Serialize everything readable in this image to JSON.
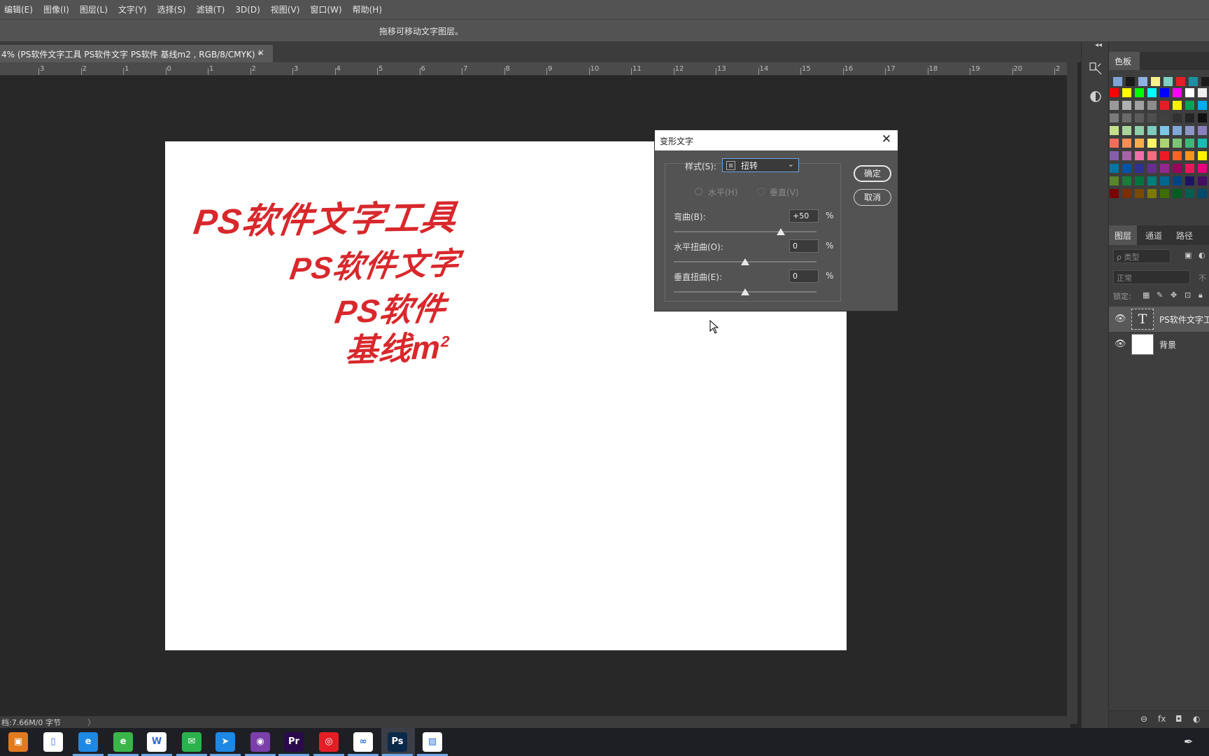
{
  "menu": [
    "编辑(E)",
    "图像(I)",
    "图层(L)",
    "文字(Y)",
    "选择(S)",
    "滤镜(T)",
    "3D(D)",
    "视图(V)",
    "窗口(W)",
    "帮助(H)"
  ],
  "options_hint": "拖移可移动文字图层。",
  "doc_tab": {
    "title": "4% (PS软件文字工具 PS软件文字 PS软件 基线m2 , RGB/8/CMYK) *",
    "close": "×"
  },
  "ruler_ticks": [
    "3",
    "2",
    "1",
    "0",
    "1",
    "2",
    "3",
    "4",
    "5",
    "6",
    "7",
    "8",
    "9",
    "10",
    "11",
    "12",
    "13",
    "14",
    "15",
    "16",
    "17",
    "18",
    "19",
    "20",
    "2"
  ],
  "canvas_text": {
    "line1": "PS软件文字工具",
    "line2": "PS软件文字",
    "line3": "PS软件",
    "line4": "基线m",
    "line4_sup": "2",
    "color": "#d8282c"
  },
  "status": {
    "text": "档:7.66M/0 字节",
    "arrow": "〉"
  },
  "dialog": {
    "title": "变形文字",
    "close": "✕",
    "style_label": "样式(S):",
    "style_value": "扭转",
    "horizontal": "水平(H)",
    "vertical": "垂直(V)",
    "bend_label": "弯曲(B):",
    "bend_value": "+50",
    "bend_level": 50,
    "hdist_label": "水平扭曲(O):",
    "hdist_value": "0",
    "hdist_level": 0,
    "vdist_label": "垂直扭曲(E):",
    "vdist_value": "0",
    "vdist_level": 0,
    "percent": "%",
    "ok": "确定",
    "cancel": "取消"
  },
  "swatches_panel": {
    "tab": "色板"
  },
  "swatch_colors": [
    [
      "#7ea4d6",
      "#1a1a1a",
      "#8fb0e0",
      "#f5f08a",
      "#7fd0c0",
      "#e41e26",
      "#1e8fa0",
      "#1a1a1a",
      "#a8d06a"
    ],
    [
      "#ff0000",
      "#ffff00",
      "#00ff00",
      "#00ffff",
      "#0000ff",
      "#ff00ff",
      "#ffffff",
      "#eeeeee"
    ],
    [
      "#9a9a9a",
      "#b0b0b0",
      "#a0a0a0",
      "#8c8c8c",
      "#e41e26",
      "#fff200",
      "#00a651",
      "#00aeef"
    ],
    [
      "#7a7a7a",
      "#6a6a6a",
      "#5c5c5c",
      "#4e4e4e",
      "#404040",
      "#323232",
      "#242424",
      "#111111"
    ],
    [
      "#c6e08a",
      "#a8d59a",
      "#8dcfaa",
      "#7ecbc0",
      "#7ec6e6",
      "#80a8d8",
      "#8e96c8",
      "#8a7fbe"
    ],
    [
      "#f26d5b",
      "#f68e56",
      "#fbad4b",
      "#fff468",
      "#acd372",
      "#7cc576",
      "#3bb878",
      "#1abbb4"
    ],
    [
      "#8560a8",
      "#a763a8",
      "#f06eaa",
      "#f26d7d",
      "#ed1c24",
      "#f26522",
      "#f7941d",
      "#fff200"
    ],
    [
      "#0076a3",
      "#0054a6",
      "#2e3192",
      "#662d91",
      "#92278f",
      "#9e005d",
      "#ed145b",
      "#e6007e"
    ],
    [
      "#598527",
      "#1b7a3a",
      "#00753e",
      "#007e7a",
      "#006890",
      "#00438a",
      "#1b1464",
      "#440e62"
    ],
    [
      "#7b0000",
      "#7b2e00",
      "#7a4a00",
      "#7a7a00",
      "#3e6e00",
      "#005e20",
      "#005e50",
      "#004a6e"
    ]
  ],
  "layers_panel": {
    "tabs": [
      "图层",
      "通道",
      "路径"
    ],
    "search_placeholder": "ρ 类型",
    "blend": "正常",
    "opacity_label": "不",
    "lock_label": "锁定:",
    "layers": [
      {
        "name": "PS软件文字工",
        "thumb": "T",
        "selected": true
      },
      {
        "name": "背景",
        "thumb": "",
        "selected": false
      }
    ],
    "footer": [
      "⊖",
      "fx",
      "◘",
      "◐"
    ]
  },
  "taskbar": {
    "apps": [
      {
        "name": "store",
        "glyph": "▣",
        "bg": "#e07b1f"
      },
      {
        "name": "file",
        "glyph": "▯",
        "bg": "#ffffff"
      },
      {
        "name": "ie",
        "glyph": "e",
        "bg": "#1e88e5"
      },
      {
        "name": "browser",
        "glyph": "e",
        "bg": "#3bb54a"
      },
      {
        "name": "wps",
        "glyph": "W",
        "bg": "#ffffff"
      },
      {
        "name": "wechat",
        "glyph": "✉",
        "bg": "#2bb24c"
      },
      {
        "name": "feishu",
        "glyph": "➤",
        "bg": "#1e88e5"
      },
      {
        "name": "ai",
        "glyph": "◉",
        "bg": "#7a3fa8"
      },
      {
        "name": "pr",
        "glyph": "Pr",
        "bg": "#2a0a4a"
      },
      {
        "name": "netease",
        "glyph": "◎",
        "bg": "#e41e26"
      },
      {
        "name": "baidu",
        "glyph": "∞",
        "bg": "#ffffff"
      },
      {
        "name": "ps",
        "glyph": "Ps",
        "bg": "#0b2a4a"
      },
      {
        "name": "ppt",
        "glyph": "▨",
        "bg": "#ffffff"
      }
    ]
  }
}
